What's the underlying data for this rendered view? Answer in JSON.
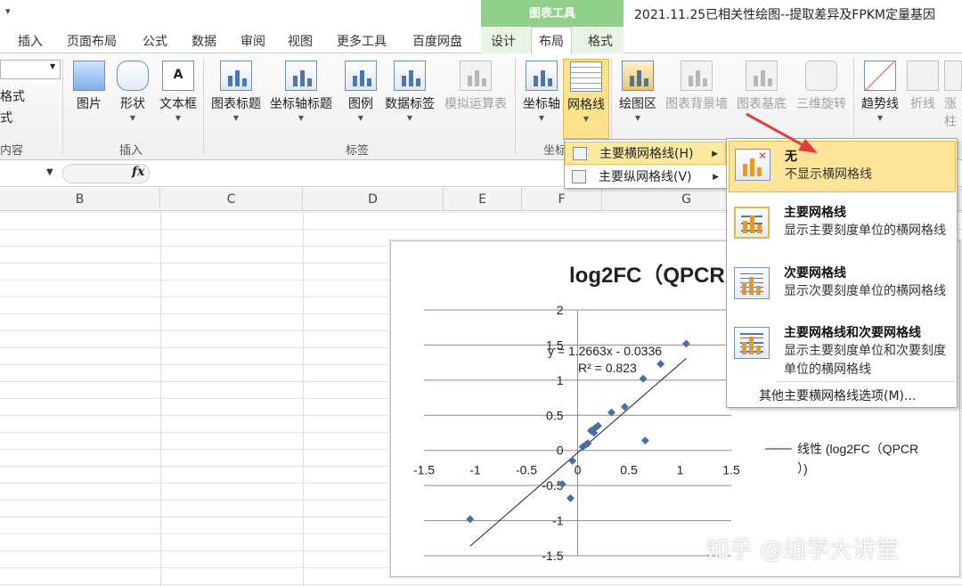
{
  "title_bar": {
    "quick_access": "▾",
    "context_tab": "图表工具",
    "document_title": "2021.11.25已相关性绘图--提取差异及FPKM定量基因"
  },
  "tabs": [
    "插入",
    "页面布局",
    "公式",
    "数据",
    "审阅",
    "视图",
    "更多工具",
    "百度网盘",
    "设计",
    "布局",
    "格式"
  ],
  "active_tab": "布局",
  "ribbon": {
    "left_partial": [
      "格式",
      "式"
    ],
    "left_group_label": "内容",
    "insert_group": {
      "label": "插入",
      "buttons": [
        "图片",
        "形状",
        "文本框"
      ]
    },
    "labels_group": {
      "label": "标签",
      "buttons": [
        "图表标题",
        "坐标轴标题",
        "图例",
        "数据标签",
        "模拟运算表"
      ]
    },
    "axes_group": {
      "label": "坐标",
      "buttons": [
        "坐标轴",
        "网格线"
      ]
    },
    "background_group": {
      "buttons": [
        "绘图区",
        "图表背景墙",
        "图表基底",
        "三维旋转"
      ]
    },
    "analysis_group": {
      "buttons": [
        "趋势线",
        "折线",
        "涨",
        "柱"
      ]
    }
  },
  "formula_bar": {
    "fx": "fx"
  },
  "columns": [
    "B",
    "C",
    "D",
    "E",
    "F",
    "G"
  ],
  "menu_gridlines": {
    "items": [
      {
        "label": "主要横网格线(H)"
      },
      {
        "label": "主要纵网格线(V)"
      }
    ]
  },
  "menu_horizontal": {
    "options": [
      {
        "title": "无",
        "desc": "不显示横网格线"
      },
      {
        "title": "主要网格线",
        "desc": "显示主要刻度单位的横网格线"
      },
      {
        "title": "次要网格线",
        "desc": "显示次要刻度单位的横网格线"
      },
      {
        "title": "主要网格线和次要网格线",
        "desc": "显示主要刻度单位和次要刻度单位的横网格线"
      }
    ],
    "more": "其他主要横网格线选项(M)..."
  },
  "chart_data": {
    "type": "scatter",
    "title": "log2FC（QPCR",
    "xlim": [
      -1.5,
      1.5
    ],
    "ylim": [
      -1.5,
      2
    ],
    "xticks": [
      "-1.5",
      "-1",
      "-0.5",
      "0",
      "0.5",
      "1",
      "1.5"
    ],
    "yticks": [
      "-1.5",
      "-1",
      "-0.5",
      "0",
      "0.5",
      "1",
      "1.5",
      "2"
    ],
    "points": [
      [
        -1.05,
        -0.98
      ],
      [
        -0.15,
        -0.48
      ],
      [
        -0.07,
        -0.68
      ],
      [
        -0.05,
        -0.15
      ],
      [
        0.05,
        0.05
      ],
      [
        0.08,
        0.08
      ],
      [
        0.1,
        0.1
      ],
      [
        0.13,
        0.28
      ],
      [
        0.16,
        0.25
      ],
      [
        0.17,
        0.32
      ],
      [
        0.2,
        0.35
      ],
      [
        0.33,
        0.54
      ],
      [
        0.46,
        0.62
      ],
      [
        0.64,
        1.02
      ],
      [
        0.66,
        0.14
      ],
      [
        0.81,
        1.23
      ],
      [
        1.06,
        1.52
      ]
    ],
    "trendline": {
      "slope": 1.2663,
      "intercept": -0.0336,
      "x_range": [
        -1.05,
        1.06
      ]
    },
    "equation": "y = 1.2663x - 0.0336",
    "r_squared": "R² = 0.823",
    "legend": [
      "线性 (log2FC（QPCR",
      "）)"
    ],
    "grid": "horizontal major",
    "marker_color": "#4a6fa8"
  },
  "watermark": "知乎 @组学大讲堂"
}
